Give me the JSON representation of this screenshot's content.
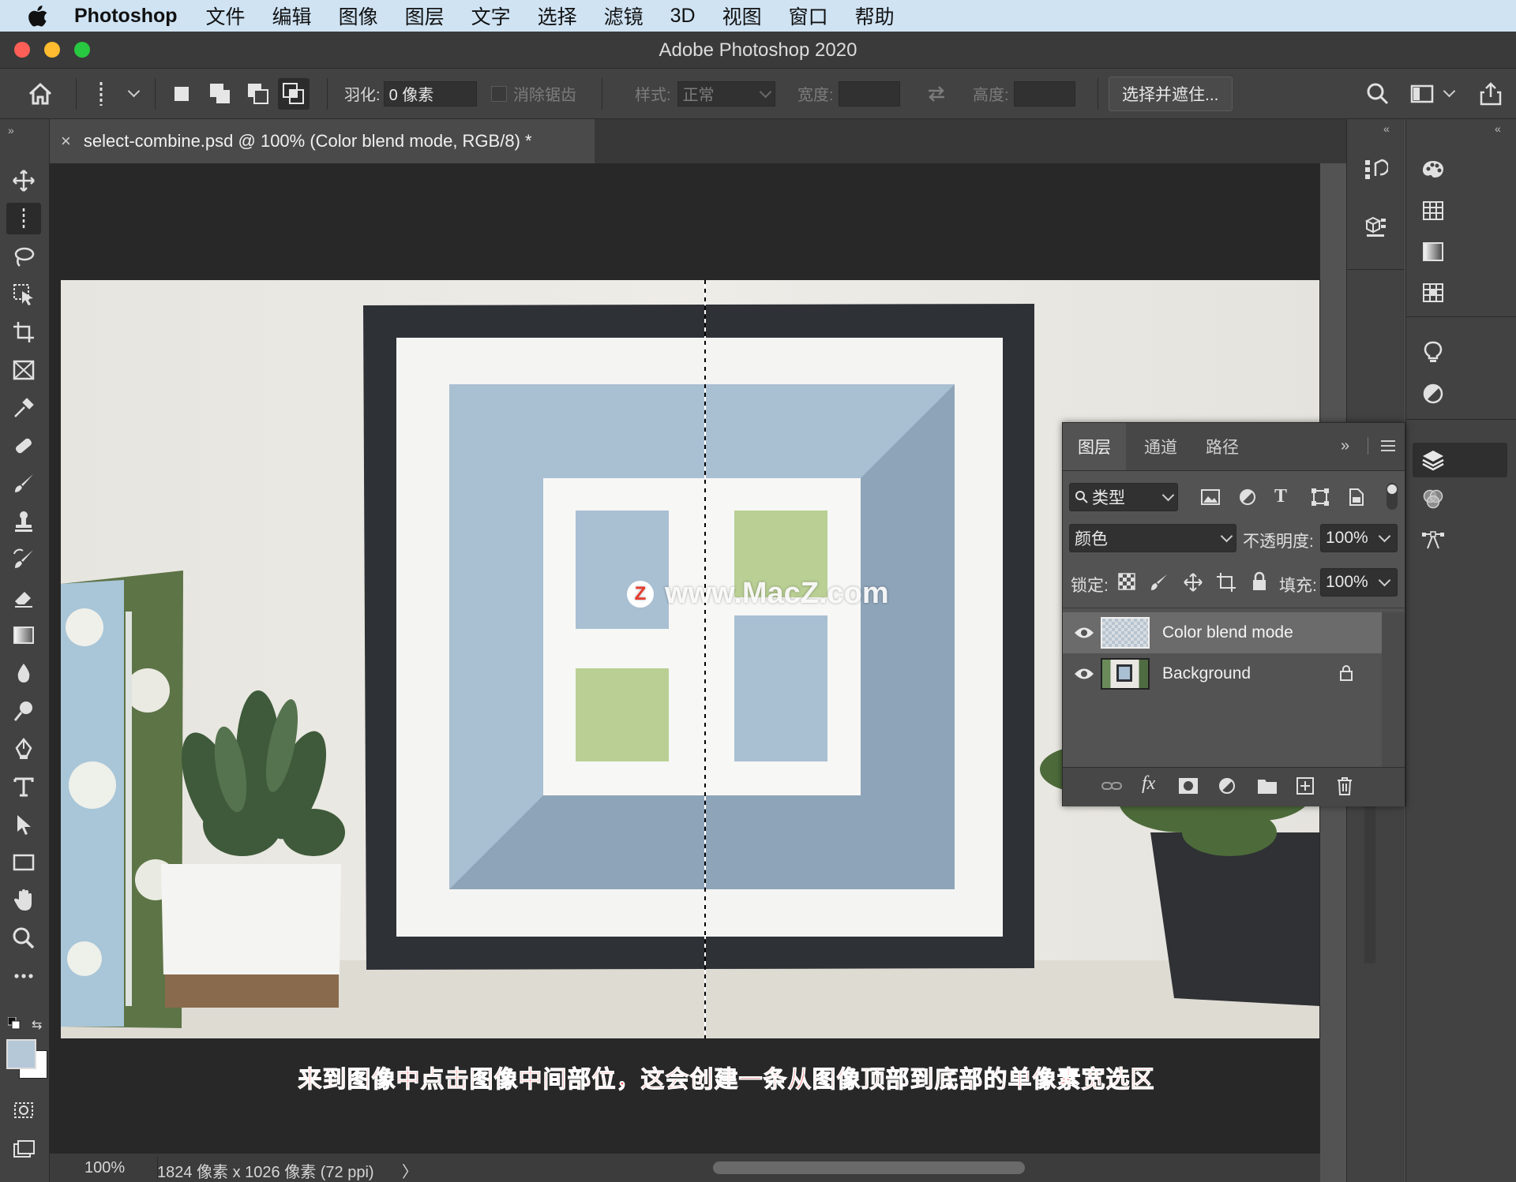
{
  "menubar": {
    "app": "Photoshop",
    "items": [
      "文件",
      "编辑",
      "图像",
      "图层",
      "文字",
      "选择",
      "滤镜",
      "3D",
      "视图",
      "窗口",
      "帮助"
    ]
  },
  "window": {
    "title": "Adobe Photoshop 2020",
    "traffic_lights": [
      "#ff5f57",
      "#febc2e",
      "#28c840"
    ]
  },
  "options_bar": {
    "feather_label": "羽化:",
    "feather_value": "0 像素",
    "antialias_label": "消除锯齿",
    "style_label": "样式:",
    "style_value": "正常",
    "width_label": "宽度:",
    "width_value": "",
    "height_label": "高度:",
    "height_value": "",
    "select_mask_button": "选择并遮住..."
  },
  "document": {
    "tab_title": "select-combine.psd @ 100% (Color blend mode, RGB/8) *",
    "close_glyph": "×",
    "watermark": "www.MacZ.com",
    "caption": "来到图像中点击图像中间部位，这会创建一条从图像顶部到底部的单像素宽选区"
  },
  "status_bar": {
    "zoom": "100%",
    "doc_info": "1824 像素 x 1026 像素 (72 ppi)",
    "arrow": "〉"
  },
  "tools": [
    "move-tool-icon",
    "single-column-marquee-tool-icon",
    "lasso-tool-icon",
    "object-select-tool-icon",
    "crop-tool-icon",
    "frame-tool-icon",
    "eyedropper-tool-icon",
    "healing-brush-tool-icon",
    "brush-tool-icon",
    "clone-stamp-tool-icon",
    "history-brush-tool-icon",
    "eraser-tool-icon",
    "gradient-tool-icon",
    "blur-tool-icon",
    "dodge-tool-icon",
    "pen-tool-icon",
    "type-tool-icon",
    "path-select-tool-icon",
    "rectangle-tool-icon",
    "hand-tool-icon",
    "zoom-tool-icon",
    "more-tools-icon"
  ],
  "colors": {
    "foreground": "#b5c8d8",
    "background": "#ffffff"
  },
  "layers_panel": {
    "tabs": [
      "图层",
      "通道",
      "路径"
    ],
    "active_tab": "图层",
    "filter_label": "类型",
    "blend_mode": "颜色",
    "opacity_label": "不透明度:",
    "opacity_value": "100%",
    "lock_label": "锁定:",
    "fill_label": "填充:",
    "fill_value": "100%",
    "layers": [
      {
        "name": "Color blend mode",
        "visible": true,
        "selected": true,
        "locked": false
      },
      {
        "name": "Background",
        "visible": true,
        "selected": false,
        "locked": true
      }
    ]
  }
}
